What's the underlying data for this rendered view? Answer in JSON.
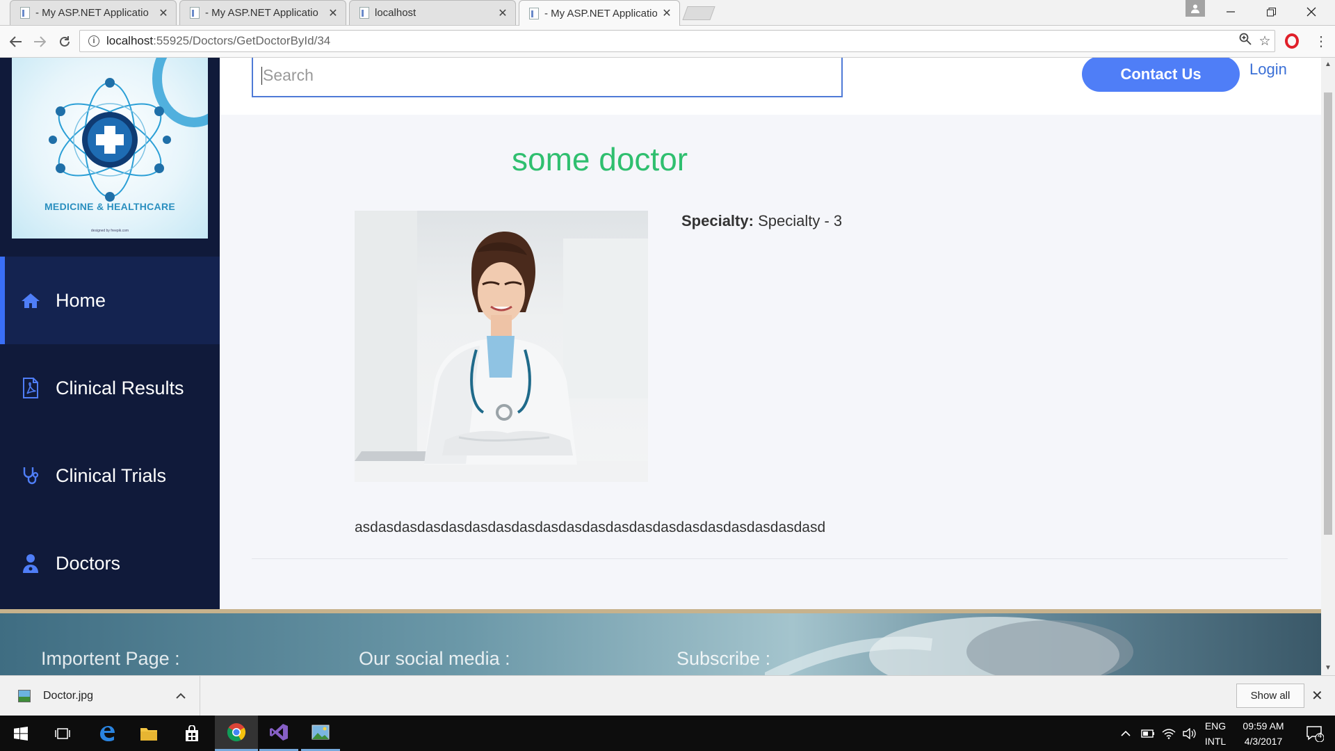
{
  "browser": {
    "tabs": [
      {
        "title": "- My ASP.NET Applicatio",
        "active": false
      },
      {
        "title": "- My ASP.NET Applicatio",
        "active": false
      },
      {
        "title": "localhost",
        "active": false
      },
      {
        "title": "- My ASP.NET Applicatio",
        "active": true
      }
    ],
    "url_host": "localhost",
    "url_rest": ":55925/Doctors/GetDoctorById/34"
  },
  "site": {
    "logo_text": "MEDICINE & HEALTHCARE",
    "logo_credit": "designed by freepik.com",
    "nav": [
      {
        "label": "Home",
        "icon": "home-icon",
        "active": true
      },
      {
        "label": "Clinical Results",
        "icon": "pdf-document-icon",
        "active": false
      },
      {
        "label": "Clinical Trials",
        "icon": "stethoscope-icon",
        "active": false
      },
      {
        "label": "Doctors",
        "icon": "doctor-icon",
        "active": false
      }
    ],
    "search_placeholder": "Search",
    "contact_label": "Contact Us",
    "login_label": "Login",
    "accent_color": "#4f7ef7"
  },
  "doctor": {
    "name": "some doctor",
    "specialty_label": "Specialty:",
    "specialty_value": "Specialty - 3",
    "description": "asdasdasdasdasdasdasdasdasdasdasdasdasdasdasdasdasdasdasdasd"
  },
  "footer": {
    "headings": [
      "Importent Page :",
      "Our social media :",
      "Subscribe :"
    ]
  },
  "downloads": {
    "file_name": "Doctor.jpg",
    "show_all_label": "Show all"
  },
  "taskbar": {
    "lang_top": "ENG",
    "lang_bottom": "INTL",
    "time": "09:59 AM",
    "date": "4/3/2017",
    "notification_count": "4"
  }
}
